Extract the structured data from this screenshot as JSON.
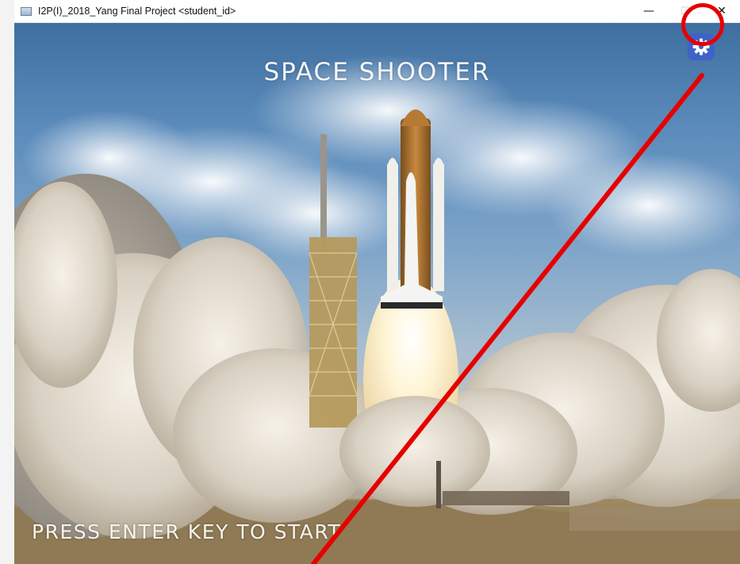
{
  "window": {
    "title": "I2P(I)_2018_Yang Final Project <student_id>",
    "controls": {
      "minimize": "—",
      "maximize": "☐",
      "close": "✕"
    }
  },
  "game": {
    "title": "SPACE SHOOTER",
    "prompt": "PRESS ENTER KEY TO START",
    "settings_icon": "gear-icon"
  },
  "annotation": {
    "highlight_color": "#e60000",
    "target": "settings-button"
  },
  "colors": {
    "settings_button": "#3f62c8",
    "sky": "#5c8cbc",
    "smoke": "#e9e4da"
  }
}
